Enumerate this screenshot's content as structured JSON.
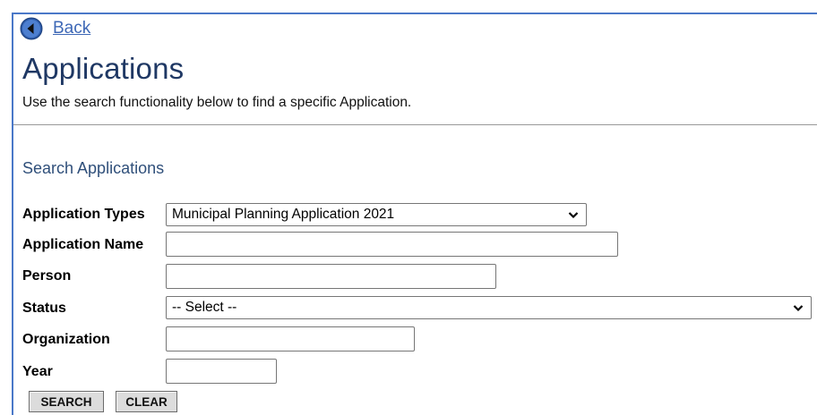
{
  "nav": {
    "back_label": "Back"
  },
  "page": {
    "title": "Applications",
    "intro": "Use the search functionality below to find a specific Application."
  },
  "search": {
    "section_title": "Search Applications",
    "fields": {
      "application_types": {
        "label": "Application Types",
        "value": "Municipal Planning Application 2021"
      },
      "application_name": {
        "label": "Application Name",
        "value": ""
      },
      "person": {
        "label": "Person",
        "value": ""
      },
      "status": {
        "label": "Status",
        "value": "-- Select --"
      },
      "organization": {
        "label": "Organization",
        "value": ""
      },
      "year": {
        "label": "Year",
        "value": ""
      }
    },
    "buttons": {
      "search_label": "SEARCH",
      "clear_label": "CLEAR"
    }
  },
  "icons": {
    "back": "back-arrow-circle-icon",
    "dropdown": "chevron-down-icon"
  },
  "colors": {
    "accent": "#3e68b6",
    "title": "#1f3864",
    "frame": "#4a78c8"
  }
}
